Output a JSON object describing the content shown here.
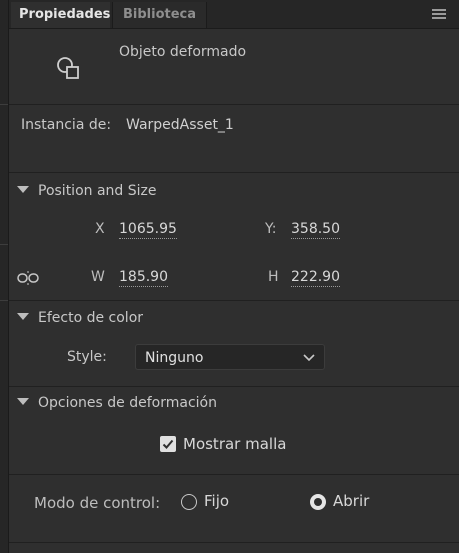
{
  "tabs": [
    {
      "label": "Propiedades",
      "active": true
    },
    {
      "label": "Biblioteca",
      "active": false
    }
  ],
  "object": {
    "icon": "warped-object-icon",
    "label": "Objeto deformado"
  },
  "instance": {
    "label": "Instancia de:",
    "value": "WarpedAsset_1"
  },
  "position_size": {
    "title": "Position and Size",
    "x_label": "X",
    "x_value": "1065.95",
    "y_label": "Y:",
    "y_value": "358.50",
    "w_label": "W",
    "w_value": "185.90",
    "h_label": "H",
    "h_value": "222.90",
    "link_icon": "link-dimensions-icon"
  },
  "color_effect": {
    "title": "Efecto de color",
    "style_label": "Style:",
    "style_value": "Ninguno"
  },
  "warp_options": {
    "title": "Opciones de deformación",
    "show_mesh_label": "Mostrar malla",
    "show_mesh_checked": true,
    "control_mode_label": "Modo de control:",
    "option_fixed": "Fijo",
    "option_open": "Abrir",
    "selected": "Abrir"
  },
  "colors": {
    "panel_bg": "#2f2f2f",
    "tab_bar_bg": "#262626",
    "text": "#c8c8c8"
  }
}
